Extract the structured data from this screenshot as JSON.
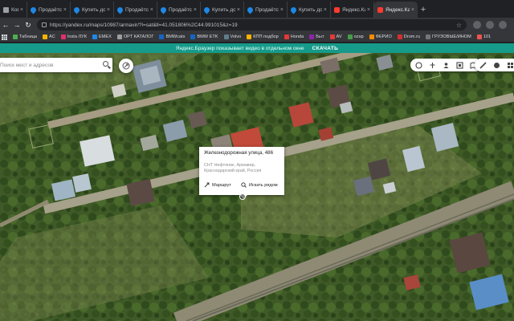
{
  "browser": {
    "tabs": [
      {
        "title": "Ковка са",
        "icon": "square-icon"
      },
      {
        "title": "Продаётся",
        "icon": "map-pin-icon"
      },
      {
        "title": "Купить дом",
        "icon": "map-pin-icon"
      },
      {
        "title": "Продаётся",
        "icon": "map-pin-icon"
      },
      {
        "title": "Продаётся",
        "icon": "map-pin-icon"
      },
      {
        "title": "Купить дом",
        "icon": "map-pin-icon"
      },
      {
        "title": "Продаётся",
        "icon": "map-pin-icon"
      },
      {
        "title": "Купить дом",
        "icon": "map-pin-icon"
      },
      {
        "title": "Яндекс.Кар",
        "icon": "yandex-icon"
      },
      {
        "title": "Яндекс.Кар",
        "icon": "yandex-icon",
        "active": true
      }
    ],
    "url": "https://yandex.ru/maps/10987/armavir/?l=sat&ll=41.051806%2C44.991015&z=19",
    "bookmarks": [
      {
        "label": "Табница",
        "color": "#4caf50"
      },
      {
        "label": "AC",
        "color": "#f4b400"
      },
      {
        "label": "Insta ЛУК",
        "color": "#e1306c"
      },
      {
        "label": "EMEX",
        "color": "#1e88e5"
      },
      {
        "label": "OPT КАТАЛОГ",
        "color": "#9e9e9e"
      },
      {
        "label": "BMWcats",
        "color": "#1565c0"
      },
      {
        "label": "BMW ETK",
        "color": "#1565c0"
      },
      {
        "label": "Volvo",
        "color": "#607d8b"
      },
      {
        "label": "КПП подбор",
        "color": "#ffb300"
      },
      {
        "label": "Honda",
        "color": "#e53935"
      },
      {
        "label": "Быт",
        "color": "#8e24aa"
      },
      {
        "label": "AV",
        "color": "#e53935"
      },
      {
        "label": "ozap",
        "color": "#43a047"
      },
      {
        "label": "ФЕРИО",
        "color": "#fb8c00"
      },
      {
        "label": "Drom.ru",
        "color": "#d32f2f"
      },
      {
        "label": "ГРУЗОВЫЕ/ИНОМ",
        "color": "#757575"
      },
      {
        "label": "101",
        "color": "#ef5350"
      }
    ]
  },
  "banner": {
    "text": "Яндекс.Браузер показывает видео в отдельном окне",
    "action": "СКАЧАТЬ"
  },
  "map": {
    "search_placeholder": "Поиск мест и адресов",
    "popup": {
      "title": "Железнодорожная улица, 486",
      "address_line1": "СНТ Нефтяник, Армавир,",
      "address_line2": "Краснодарский край, Россия",
      "route_label": "Маршрут",
      "nearby_label": "Искать рядом"
    }
  }
}
